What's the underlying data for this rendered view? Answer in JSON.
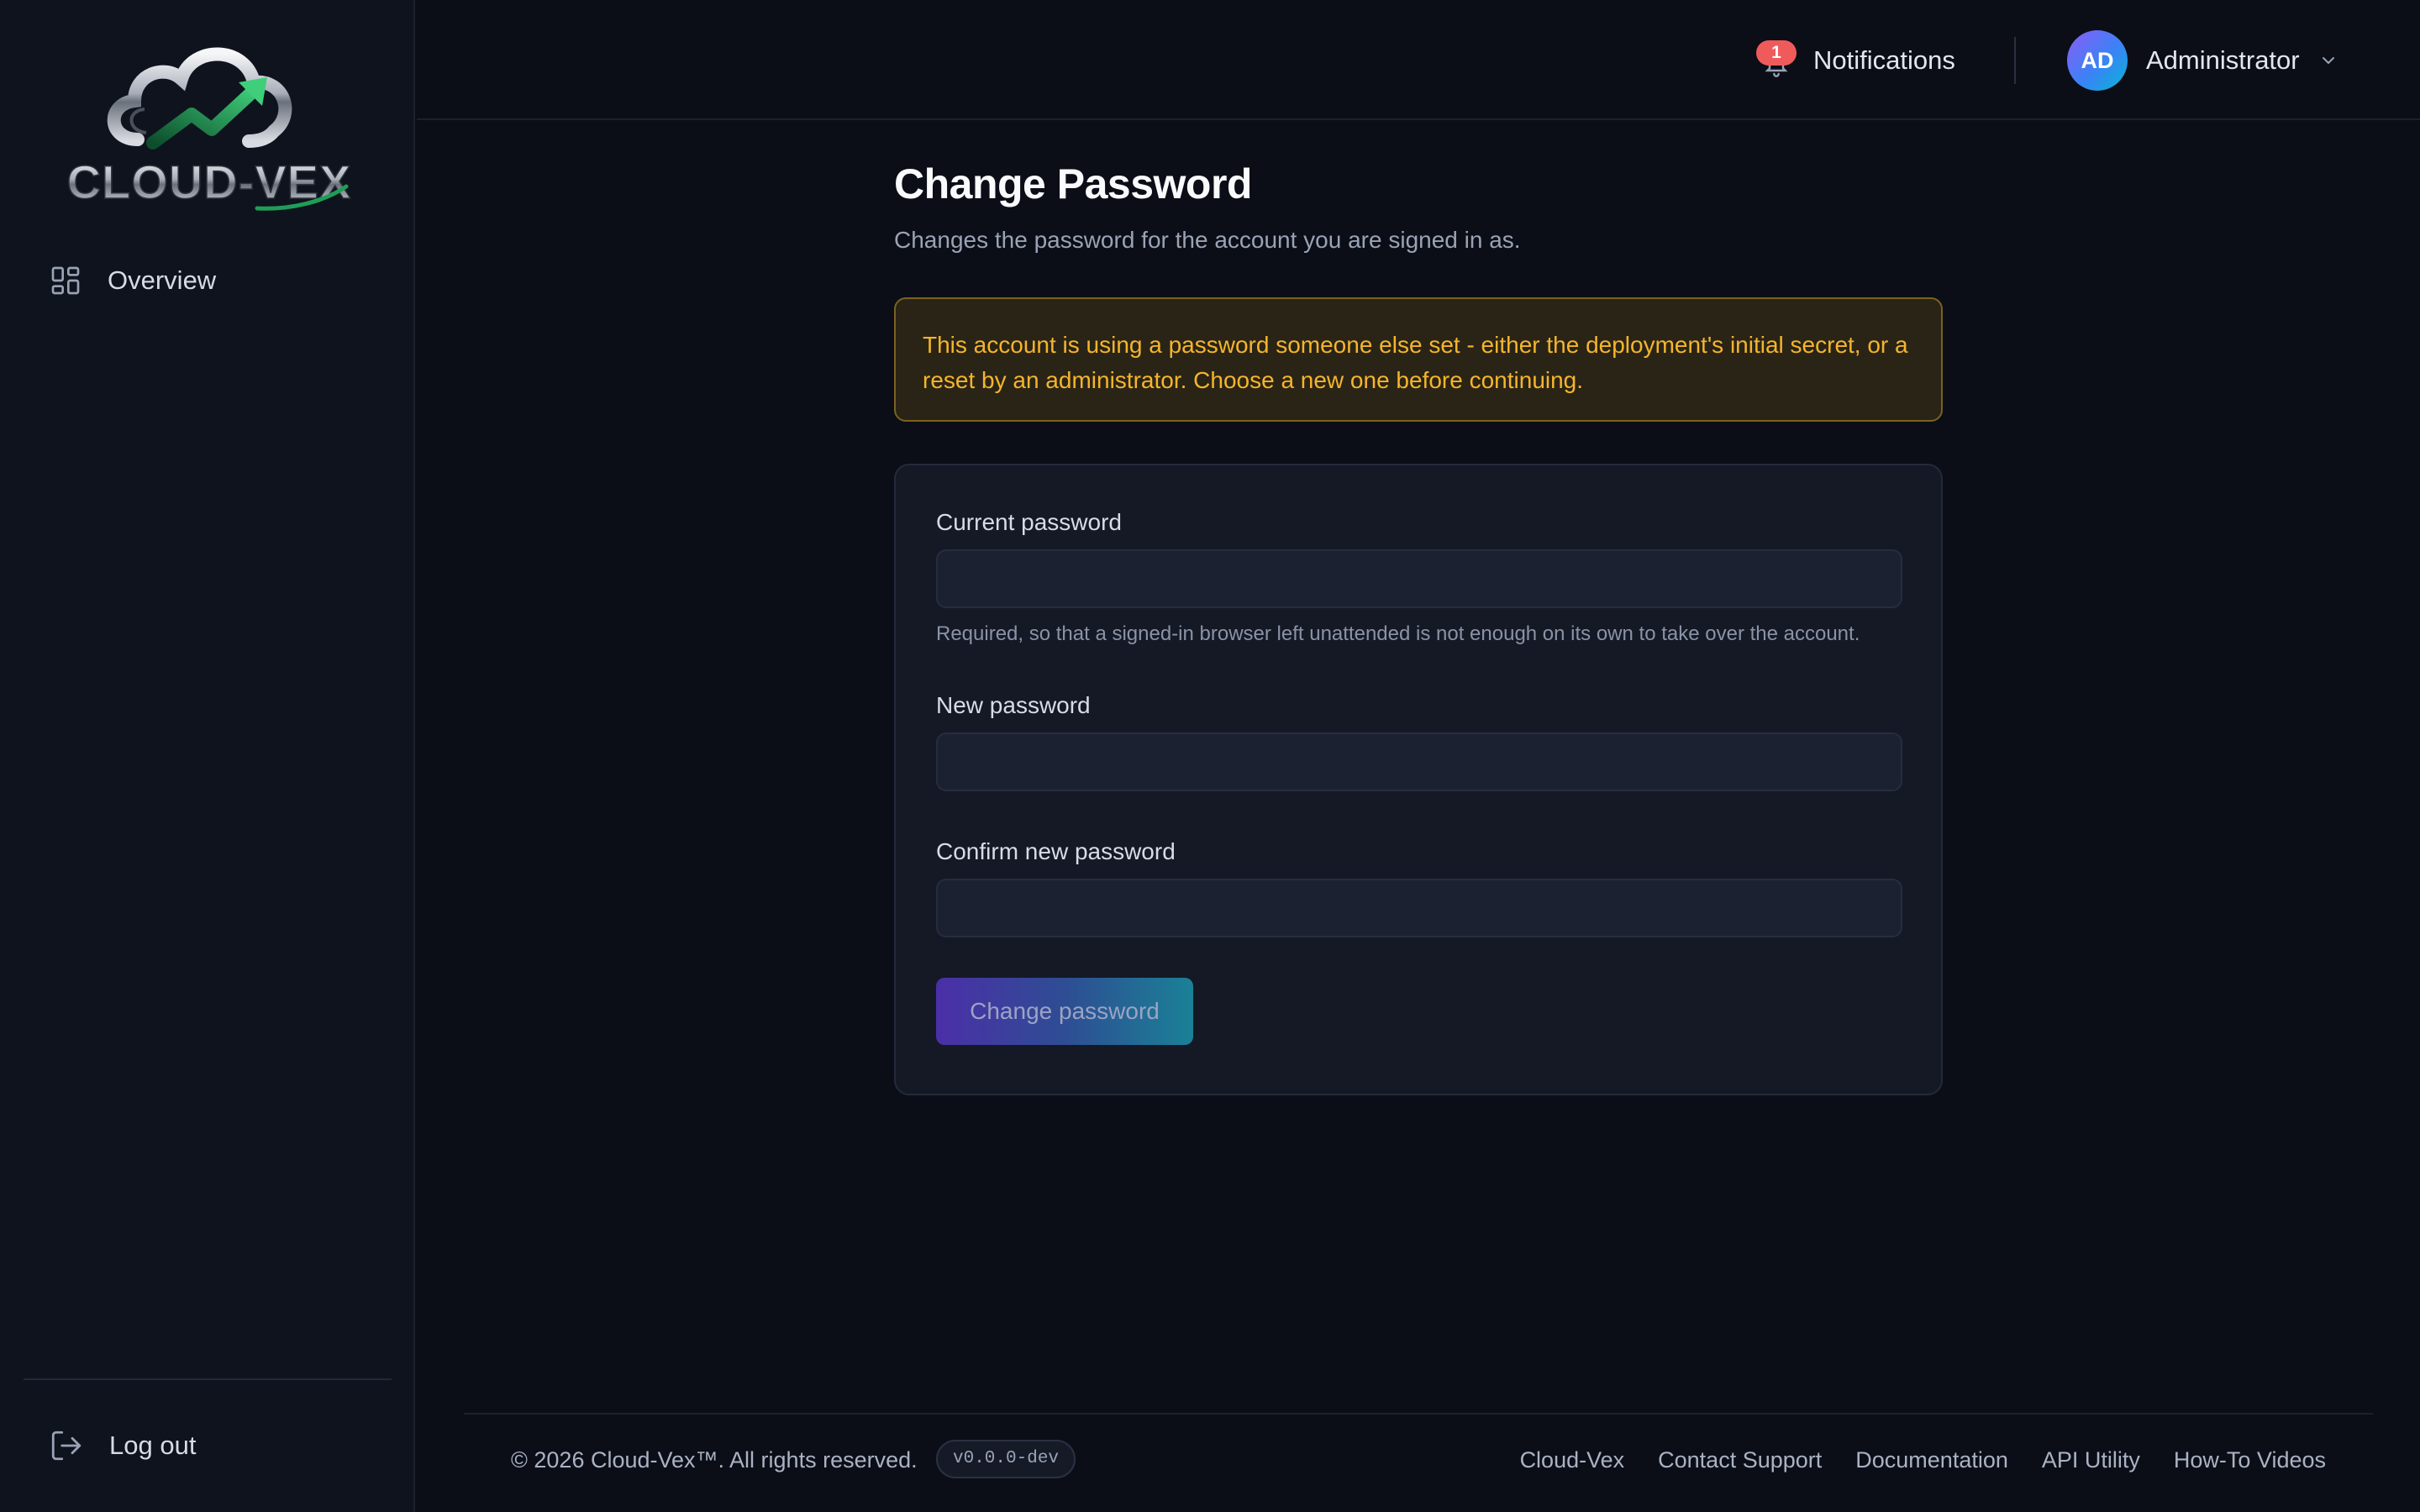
{
  "brand": {
    "logo_text": "CLOUD-VEX"
  },
  "sidebar": {
    "items": [
      {
        "label": "Overview",
        "icon": "grid-icon"
      }
    ],
    "logout": {
      "label": "Log out",
      "icon": "logout-icon"
    }
  },
  "header": {
    "notifications": {
      "label": "Notifications",
      "count": "1"
    },
    "user": {
      "initials": "AD",
      "name": "Administrator"
    }
  },
  "main": {
    "title": "Change Password",
    "subtitle": "Changes the password for the account you are signed in as.",
    "alert": "This account is using a password someone else set - either the deployment's initial secret, or a reset by an administrator. Choose a new one before continuing.",
    "form": {
      "current_label": "Current password",
      "current_hint": "Required, so that a signed-in browser left unattended is not enough on its own to take over the account.",
      "new_label": "New password",
      "confirm_label": "Confirm new password",
      "submit_label": "Change password"
    }
  },
  "footer": {
    "copyright": "© 2026 Cloud-Vex™. All rights reserved.",
    "version": "v0.0.0-dev",
    "links": [
      "Cloud-Vex",
      "Contact Support",
      "Documentation",
      "API Utility",
      "How-To Videos"
    ]
  },
  "colors": {
    "background": "#0b0e17",
    "alert_text": "#f5b52c",
    "badge": "#ef5b5b",
    "button_gradient_start": "#4b2fa8",
    "button_gradient_end": "#1a8196"
  }
}
